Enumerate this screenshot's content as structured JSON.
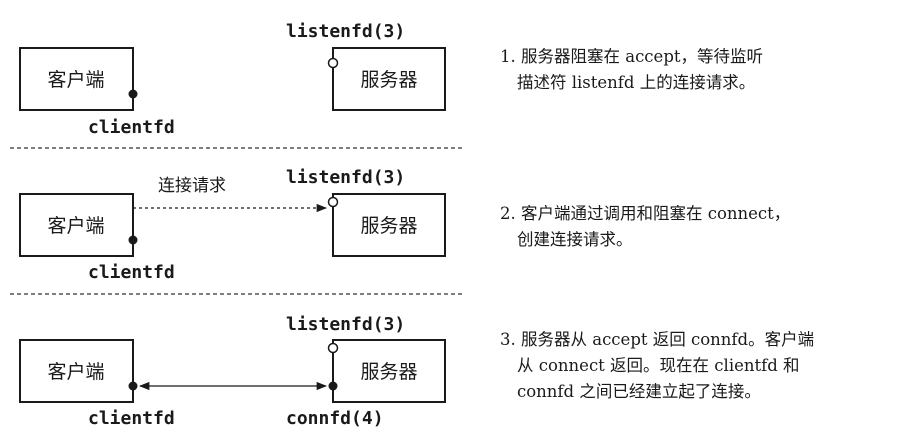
{
  "client_label": "客户端",
  "server_label": "服务器",
  "clientfd": "clientfd",
  "listenfd": "listenfd(3)",
  "connfd": "connfd(4)",
  "request_label": "连接请求",
  "steps": [
    {
      "lines": [
        "1. 服务器阻塞在 accept，等待监听",
        "描述符 listenfd 上的连接请求。"
      ]
    },
    {
      "lines": [
        "2. 客户端通过调用和阻塞在 connect，",
        "创建连接请求。"
      ]
    },
    {
      "lines": [
        "3. 服务器从 accept 返回 connfd。客户端",
        "从 connect 返回。现在在 clientfd 和",
        "connfd 之间已经建立起了连接。"
      ]
    }
  ]
}
